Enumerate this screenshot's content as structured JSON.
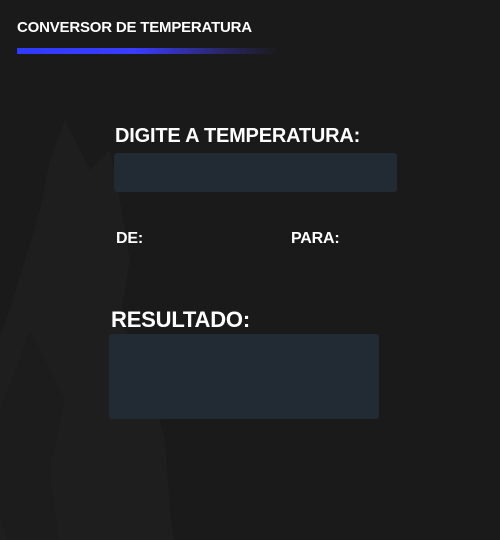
{
  "header": {
    "title": "CONVERSOR DE TEMPERATURA"
  },
  "form": {
    "input_label": "DIGITE A TEMPERATURA:",
    "input_value": "",
    "from_label": "DE:",
    "to_label": "PARA:",
    "result_label": "RESULTADO:",
    "result_value": ""
  },
  "colors": {
    "background": "#1a1a1a",
    "accent": "#2f3bff",
    "field": "#222a33",
    "text": "#ffffff"
  },
  "icons": {
    "background_art": "cat-silhouette-icon"
  }
}
